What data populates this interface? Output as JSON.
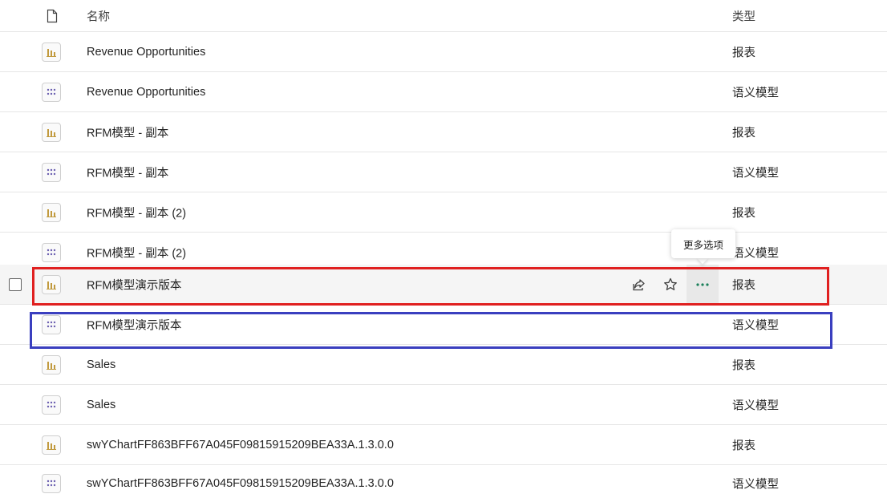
{
  "header": {
    "name_label": "名称",
    "type_label": "类型",
    "icon": "file-icon"
  },
  "rows": [
    {
      "name": "Revenue Opportunities",
      "type": "报表",
      "icon": "report-icon"
    },
    {
      "name": "Revenue Opportunities",
      "type": "语义模型",
      "icon": "semantic-model-icon"
    },
    {
      "name": "RFM模型 - 副本",
      "type": "报表",
      "icon": "report-icon"
    },
    {
      "name": "RFM模型 - 副本",
      "type": "语义模型",
      "icon": "semantic-model-icon"
    },
    {
      "name": "RFM模型 - 副本 (2)",
      "type": "报表",
      "icon": "report-icon"
    },
    {
      "name": "RFM模型 - 副本 (2)",
      "type": "语义模型",
      "icon": "semantic-model-icon"
    },
    {
      "name": "RFM模型演示版本",
      "type": "报表",
      "icon": "report-icon",
      "hovered": true
    },
    {
      "name": "RFM模型演示版本",
      "type": "语义模型",
      "icon": "semantic-model-icon"
    },
    {
      "name": "Sales",
      "type": "报表",
      "icon": "report-icon"
    },
    {
      "name": "Sales",
      "type": "语义模型",
      "icon": "semantic-model-icon"
    },
    {
      "name": "swYChartFF863BFF67A045F09815915209BEA33A.1.3.0.0",
      "type": "报表",
      "icon": "report-icon"
    },
    {
      "name": "swYChartFF863BFF67A045F09815915209BEA33A.1.3.0.0",
      "type": "语义模型",
      "icon": "semantic-model-icon"
    }
  ],
  "hover_actions": {
    "share_icon": "share-icon",
    "favorite_icon": "star-icon",
    "more_icon": "more-options-icon"
  },
  "tooltip": {
    "text": "更多选项"
  },
  "colors": {
    "report_icon": "#c19a3e",
    "semantic_model_icon": "#6b5fb0",
    "more_icon": "#1a7f5a",
    "highlight_red": "#e02020",
    "highlight_blue": "#3a3fbf"
  }
}
